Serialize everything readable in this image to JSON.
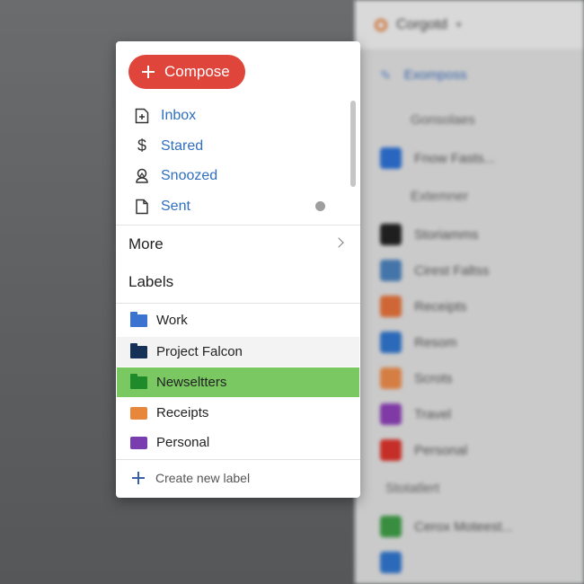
{
  "compose": {
    "label": "Compose"
  },
  "nav": [
    {
      "label": "Inbox",
      "icon": "inbox-icon"
    },
    {
      "label": "Stared",
      "icon": "dollar-icon"
    },
    {
      "label": "Snoozed",
      "icon": "snooze-icon"
    },
    {
      "label": "Sent",
      "icon": "document-icon"
    }
  ],
  "more": {
    "label": "More"
  },
  "labels": {
    "heading": "Labels",
    "items": [
      {
        "label": "Work",
        "color": "#3a74d0",
        "icon": "folder-icon"
      },
      {
        "label": "Project Falcon",
        "color": "#163158",
        "icon": "folder-icon"
      },
      {
        "label": "Newseltters",
        "color": "#1f8a2a",
        "icon": "folder-icon"
      },
      {
        "label": "Receipts",
        "color": "#e7873b",
        "icon": "tag-icon"
      },
      {
        "label": "Personal",
        "color": "#7a3db0",
        "icon": "tag-icon"
      }
    ],
    "create": "Create new label"
  },
  "colors": {
    "compose_bg": "#e0453c",
    "nav_text": "#2f6fc0",
    "selected_bg": "#79c862"
  },
  "background": {
    "search_text": "Corgotd",
    "compose_text": "Exomposs",
    "rows": [
      "Gonsolaes",
      "Fnow Fasts...",
      "Extemner",
      "Storiamms",
      "Cirest Faltss",
      "Receipts",
      "Resom",
      "Scrots",
      "Travel",
      "Personal",
      "Stotatlert",
      "Cerox Moteest..."
    ]
  }
}
